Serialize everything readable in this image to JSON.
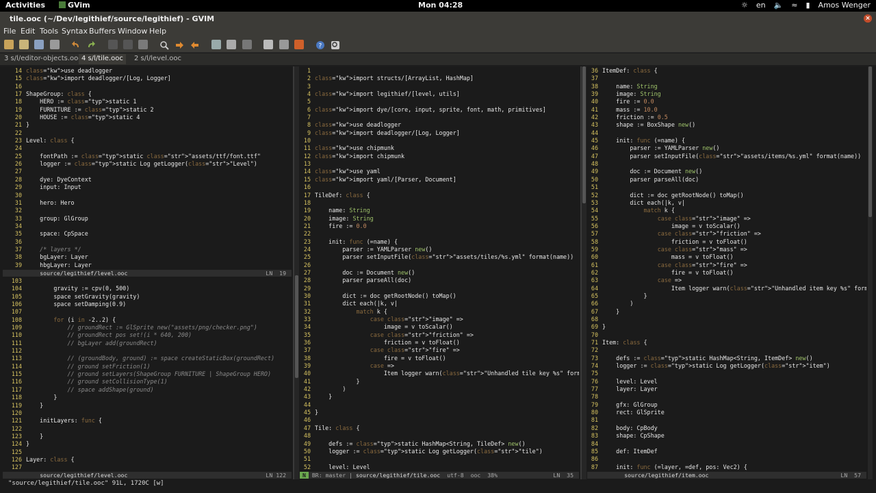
{
  "topbar": {
    "activities": "Activities",
    "app": "GVim",
    "clock": "Mon 04:28",
    "language": "en",
    "user": "Amos Wenger"
  },
  "window": {
    "title": "tile.ooc (~/Dev/legithief/source/legithief) - GVIM"
  },
  "menu": [
    "File",
    "Edit",
    "Tools",
    "Syntax",
    "Buffers",
    "Window",
    "Help"
  ],
  "toolbar_icons": [
    "open-icon",
    "save-icon",
    "save-all-icon",
    "print-icon",
    "undo-icon",
    "redo-icon",
    "cut-icon",
    "copy-icon",
    "paste-icon",
    "find-icon",
    "find-next-icon",
    "find-prev-icon",
    "load-session-icon",
    "save-session-icon",
    "run-script-icon",
    "make-icon",
    "build-tags-icon",
    "jump-tag-icon",
    "help-icon",
    "find-help-icon"
  ],
  "tabs": [
    "3 s/l/editor-objects.ooc",
    "4 s/l/tile.ooc",
    "2 s/l/level.ooc"
  ],
  "panes": {
    "left_top": [
      [
        "14",
        "use deadlogger"
      ],
      [
        "15",
        "import deadlogger/[Log, Logger]"
      ],
      [
        "16",
        ""
      ],
      [
        "17",
        "ShapeGroup: class {"
      ],
      [
        "18",
        "    HERO := static 1"
      ],
      [
        "19",
        "    FURNITURE := static 2"
      ],
      [
        "20",
        "    HOUSE := static 4"
      ],
      [
        "21",
        "}"
      ],
      [
        "22",
        ""
      ],
      [
        "23",
        "Level: class {"
      ],
      [
        "24",
        ""
      ],
      [
        "25",
        "    fontPath := static \"assets/ttf/font.ttf\""
      ],
      [
        "26",
        "    logger := static Log getLogger(\"Level\")"
      ],
      [
        "27",
        ""
      ],
      [
        "28",
        "    dye: DyeContext"
      ],
      [
        "29",
        "    input: Input"
      ],
      [
        "30",
        ""
      ],
      [
        "31",
        "    hero: Hero"
      ],
      [
        "32",
        ""
      ],
      [
        "33",
        "    group: GlGroup"
      ],
      [
        "34",
        ""
      ],
      [
        "35",
        "    space: CpSpace"
      ],
      [
        "36",
        ""
      ],
      [
        "37",
        "    /* layers */"
      ],
      [
        "38",
        "    bgLayer: Layer"
      ],
      [
        "39",
        "    hbgLayer: Layer"
      ]
    ],
    "left_bottom": [
      [
        "103",
        ""
      ],
      [
        "104",
        "        gravity := cpv(0, 500)"
      ],
      [
        "105",
        "        space setGravity(gravity)"
      ],
      [
        "106",
        "        space setDamping(0.9)"
      ],
      [
        "107",
        ""
      ],
      [
        "108",
        "        for (i in -2..2) {"
      ],
      [
        "109",
        "            // groundRect := GlSprite new(\"assets/png/checker.png\")"
      ],
      [
        "110",
        "            // groundRect pos set!(i * 640, 200)"
      ],
      [
        "111",
        "            // bgLayer add(groundRect)"
      ],
      [
        "112",
        ""
      ],
      [
        "113",
        "            // (groundBody, ground) := space createStaticBox(groundRect)"
      ],
      [
        "114",
        "            // ground setFriction(1)"
      ],
      [
        "115",
        "            // ground setLayers(ShapeGroup FURNITURE | ShapeGroup HERO)"
      ],
      [
        "116",
        "            // ground setCollisionType(1)"
      ],
      [
        "117",
        "            // space addShape(ground)"
      ],
      [
        "118",
        "        }"
      ],
      [
        "119",
        "    }"
      ],
      [
        "120",
        ""
      ],
      [
        "121",
        "    initLayers: func {"
      ],
      [
        "122",
        ""
      ],
      [
        "123",
        "    }"
      ],
      [
        "124",
        "}"
      ],
      [
        "125",
        ""
      ],
      [
        "126",
        "Layer: class {"
      ],
      [
        "127",
        ""
      ]
    ],
    "middle": [
      [
        "1",
        ""
      ],
      [
        "2",
        "import structs/[ArrayList, HashMap]"
      ],
      [
        "3",
        ""
      ],
      [
        "4",
        "import legithief/[level, utils]"
      ],
      [
        "5",
        ""
      ],
      [
        "6",
        "import dye/[core, input, sprite, font, math, primitives]"
      ],
      [
        "7",
        ""
      ],
      [
        "8",
        "use deadlogger"
      ],
      [
        "9",
        "import deadlogger/[Log, Logger]"
      ],
      [
        "10",
        ""
      ],
      [
        "11",
        "use chipmunk"
      ],
      [
        "12",
        "import chipmunk"
      ],
      [
        "13",
        ""
      ],
      [
        "14",
        "use yaml"
      ],
      [
        "15",
        "import yaml/[Parser, Document]"
      ],
      [
        "16",
        ""
      ],
      [
        "17",
        "TileDef: class {"
      ],
      [
        "18",
        ""
      ],
      [
        "19",
        "    name: String"
      ],
      [
        "20",
        "    image: String"
      ],
      [
        "21",
        "    fire := 0.0"
      ],
      [
        "22",
        ""
      ],
      [
        "23",
        "    init: func (=name) {"
      ],
      [
        "24",
        "        parser := YAMLParser new()"
      ],
      [
        "25",
        "        parser setInputFile(\"assets/tiles/%s.yml\" format(name))"
      ],
      [
        "26",
        ""
      ],
      [
        "27",
        "        doc := Document new()"
      ],
      [
        "28",
        "        parser parseAll(doc)"
      ],
      [
        "29",
        ""
      ],
      [
        "30",
        "        dict := doc getRootNode() toMap()"
      ],
      [
        "31",
        "        dict each(|k, v|"
      ],
      [
        "32",
        "            match k {"
      ],
      [
        "33",
        "                case \"image\" =>"
      ],
      [
        "34",
        "                    image = v toScalar()"
      ],
      [
        "35",
        "                case \"friction\" =>"
      ],
      [
        "36",
        "                    friction = v toFloat()"
      ],
      [
        "37",
        "                case \"fire\" =>"
      ],
      [
        "38",
        "                    fire = v toFloat()"
      ],
      [
        "39",
        "                case =>"
      ],
      [
        "40",
        "                    Item logger warn(\"Unhandled tile key %s\" format(k))"
      ],
      [
        "41",
        "            }"
      ],
      [
        "42",
        "        )"
      ],
      [
        "43",
        "    }"
      ],
      [
        "44",
        ""
      ],
      [
        "45",
        "}"
      ],
      [
        "46",
        ""
      ],
      [
        "47",
        "Tile: class {"
      ],
      [
        "48",
        ""
      ],
      [
        "49",
        "    defs := static HashMap<String, TileDef> new()"
      ],
      [
        "50",
        "    logger := static Log getLogger(\"tile\")"
      ],
      [
        "51",
        ""
      ],
      [
        "52",
        "    level: Level"
      ]
    ],
    "right": [
      [
        "36",
        "ItemDef: class {"
      ],
      [
        "37",
        ""
      ],
      [
        "38",
        "    name: String"
      ],
      [
        "39",
        "    image: String"
      ],
      [
        "40",
        "    fire := 0.0"
      ],
      [
        "41",
        "    mass := 10.0"
      ],
      [
        "42",
        "    friction := 0.5"
      ],
      [
        "43",
        "    shape := BoxShape new()"
      ],
      [
        "44",
        ""
      ],
      [
        "45",
        "    init: func (=name) {"
      ],
      [
        "46",
        "        parser := YAMLParser new()"
      ],
      [
        "47",
        "        parser setInputFile(\"assets/items/%s.yml\" format(name))"
      ],
      [
        "48",
        ""
      ],
      [
        "49",
        "        doc := Document new()"
      ],
      [
        "50",
        "        parser parseAll(doc)"
      ],
      [
        "51",
        ""
      ],
      [
        "52",
        "        dict := doc getRootNode() toMap()"
      ],
      [
        "53",
        "        dict each(|k, v|"
      ],
      [
        "54",
        "            match k {"
      ],
      [
        "55",
        "                case \"image\" =>"
      ],
      [
        "56",
        "                    image = v toScalar()"
      ],
      [
        "57",
        "                case \"friction\" =>"
      ],
      [
        "58",
        "                    friction = v toFloat()"
      ],
      [
        "59",
        "                case \"mass\" =>"
      ],
      [
        "60",
        "                    mass = v toFloat()"
      ],
      [
        "61",
        "                case \"fire\" =>"
      ],
      [
        "62",
        "                    fire = v toFloat()"
      ],
      [
        "63",
        "                case =>"
      ],
      [
        "64",
        "                    Item logger warn(\"Unhandled item key %s\" format(k))"
      ],
      [
        "65",
        "            }"
      ],
      [
        "66",
        "        )"
      ],
      [
        "67",
        "    }"
      ],
      [
        "68",
        ""
      ],
      [
        "69",
        "}"
      ],
      [
        "70",
        ""
      ],
      [
        "71",
        "Item: class {"
      ],
      [
        "72",
        ""
      ],
      [
        "73",
        "    defs := static HashMap<String, ItemDef> new()"
      ],
      [
        "74",
        "    logger := static Log getLogger(\"item\")"
      ],
      [
        "75",
        ""
      ],
      [
        "76",
        "    level: Level"
      ],
      [
        "77",
        "    layer: Layer"
      ],
      [
        "78",
        ""
      ],
      [
        "79",
        "    gfx: GlGroup"
      ],
      [
        "80",
        "    rect: GlSprite"
      ],
      [
        "81",
        ""
      ],
      [
        "82",
        "    body: CpBody"
      ],
      [
        "83",
        "    shape: CpShape"
      ],
      [
        "84",
        ""
      ],
      [
        "85",
        "    def: ItemDef"
      ],
      [
        "86",
        ""
      ],
      [
        "87",
        "    init: func (=layer, =def, pos: Vec2) {"
      ]
    ]
  },
  "status": {
    "left_top_file": "source/legithief/level.ooc",
    "left_top_ln": "LN  19",
    "left_bottom_file": "source/legithief/level.ooc",
    "left_bottom_ln": "LN 122",
    "middle_mode": "N",
    "middle_branch": "BR: master",
    "middle_file": "source/legithief/tile.ooc",
    "middle_enc": "utf-8",
    "middle_ft": "ooc",
    "middle_pct": "38%",
    "middle_ln": "LN  35",
    "right_file": "source/legithief/item.ooc",
    "right_ln": "LN  57"
  },
  "cmdline": "\"source/legithief/tile.ooc\" 91L, 1720C [w]",
  "colors": {
    "linenr": "#d6c260",
    "keyword": "#8a6a3e",
    "string": "#c58b7d",
    "type": "#9fc36a",
    "statusline_mode": "#6aa84f"
  }
}
